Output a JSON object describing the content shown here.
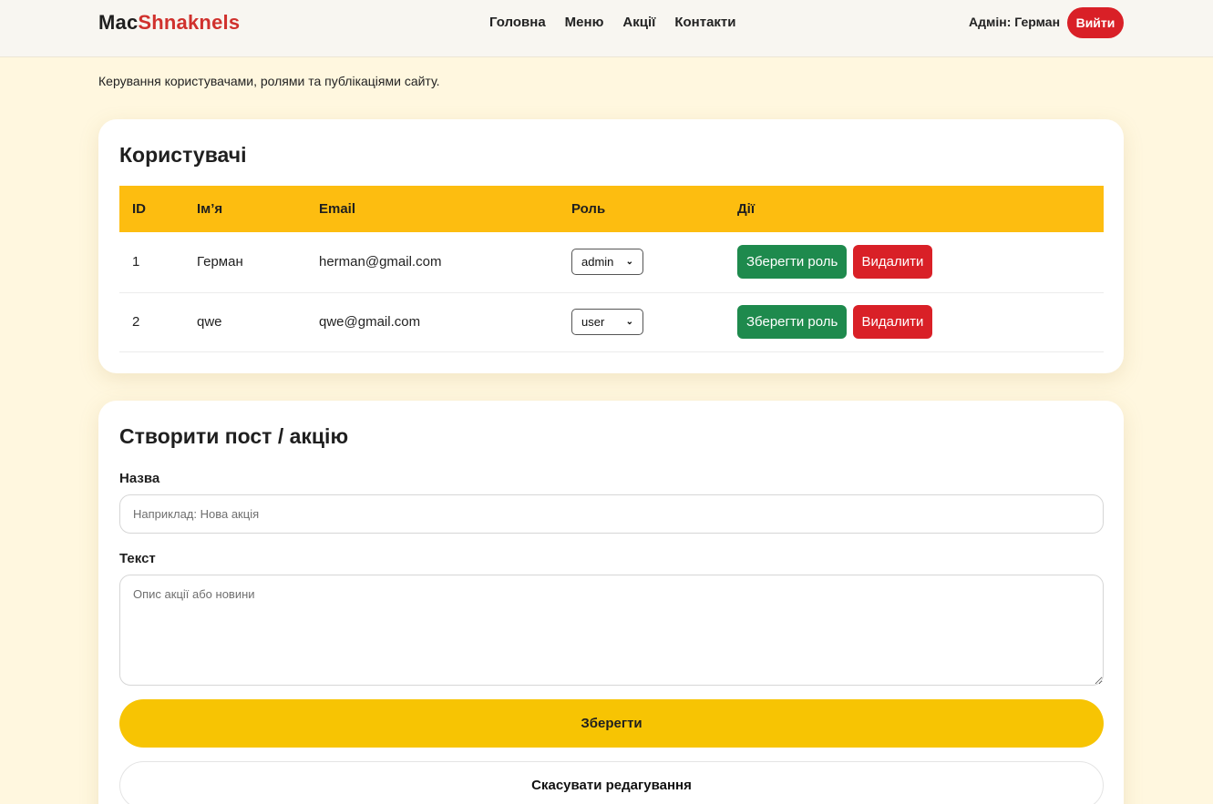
{
  "header": {
    "logo_prefix": "Mac",
    "logo_accent": "Shnaknels",
    "nav": [
      {
        "label": "Головна"
      },
      {
        "label": "Меню"
      },
      {
        "label": "Акції"
      },
      {
        "label": "Контакти"
      }
    ],
    "admin_label": "Адмін: Герман",
    "logout_label": "Вийти"
  },
  "intro_text": "Керування користувачами, ролями та публікаціями сайту.",
  "users": {
    "title": "Користувачі",
    "columns": [
      "ID",
      "Ім’я",
      "Email",
      "Роль",
      "Дії"
    ],
    "rows": [
      {
        "id": "1",
        "name": "Герман",
        "email": "herman@gmail.com",
        "role": "admin"
      },
      {
        "id": "2",
        "name": "qwe",
        "email": "qwe@gmail.com",
        "role": "user"
      }
    ],
    "save_role_label": "Зберегти роль",
    "delete_label": "Видалити"
  },
  "post_form": {
    "title": "Створити пост / акцію",
    "title_label": "Назва",
    "title_placeholder": "Наприклад: Нова акція",
    "title_value": "",
    "text_label": "Текст",
    "text_placeholder": "Опис акції або новини",
    "text_value": "",
    "save_label": "Зберегти",
    "cancel_label": "Скасувати редагування"
  },
  "colors": {
    "page_bg": "#fff7df",
    "accent_red": "#d92027",
    "table_header": "#fdbd10",
    "save_green": "#1e8a4d",
    "save_yellow": "#f7c403"
  }
}
